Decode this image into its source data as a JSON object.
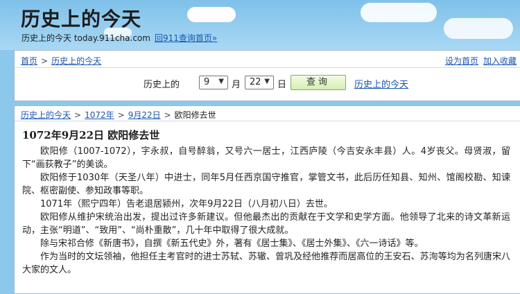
{
  "header": {
    "title": "历史上的今天",
    "subtitle": "历史上的今天 today.911cha.com",
    "home_link": "回911查询首页»"
  },
  "top_nav": {
    "breadcrumb": [
      "首页",
      "历史上的今天"
    ],
    "set_home": "设为首页",
    "add_favorite": "加入收藏"
  },
  "query": {
    "prefix": "历史上的",
    "month_value": "9",
    "month_unit": "月",
    "day_value": "22",
    "day_unit": "日",
    "button": "查询",
    "link": "历史上的今天"
  },
  "article": {
    "breadcrumb": [
      "历史上的今天",
      "1072年",
      "9月22日"
    ],
    "breadcrumb_current": "欧阳修去世",
    "title": "1072年9月22日 欧阳修去世",
    "paragraphs": [
      "欧阳修（1007-1072），字永叔，自号醉翁，又号六一居士，江西庐陵（今吉安永丰县）人。4岁丧父。母贤淑，留下“画荻教子”的美谈。",
      "欧阳修于1030年（天圣八年）中进士，同年5月任西京国守推官，掌管文书，此后历任知县、知州、馆阁校勘、知谏院、枢密副使、参知政事等职。",
      "1071年（熙宁四年）告老退居颍州，次年9月22日（八月初八日）去世。",
      "欧阳修从维护宋统治出发，提出过许多新建议。但他最杰出的贡献在于文学和史学方面。他领导了北来的诗文革新运动，主张“明道”、“致用”、“尚朴重散”，几十年中取得了很大成就。",
      "除与宋祁合修《新唐书》，自撰《新五代史》外，著有《居士集》、《居士外集》、《六一诗话》等。",
      "作为当时的文坛领袖，他担任主考官时的进士苏轼、苏辙、曾巩及经他推荐而居高位的王安石、苏洵等均为名列唐宋八大家的文人。"
    ]
  }
}
